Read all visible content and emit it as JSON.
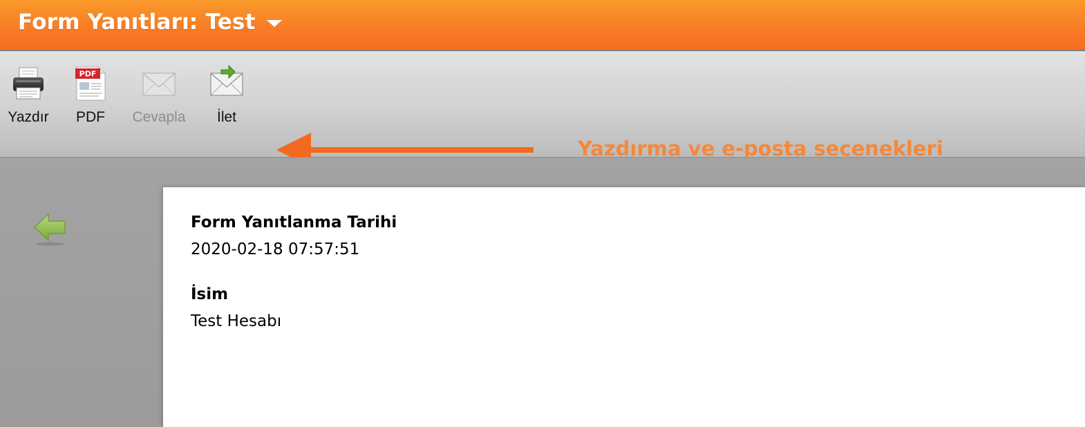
{
  "header": {
    "title": "Form Yanıtları: Test",
    "bg_color": "#f87a26"
  },
  "toolbar": {
    "items": [
      {
        "label": "Yazdır",
        "icon": "printer-icon",
        "enabled": true
      },
      {
        "label": "PDF",
        "icon": "pdf-icon",
        "icon_text": "PDF",
        "enabled": true
      },
      {
        "label": "Cevapla",
        "icon": "envelope-icon",
        "enabled": false
      },
      {
        "label": "İlet",
        "icon": "forward-envelope-icon",
        "enabled": true
      }
    ],
    "annotation": {
      "text": "Yazdırma ve e-posta seçenekleri",
      "color": "#f5883a",
      "arrow_color": "#f26a1f"
    }
  },
  "nav": {
    "back_icon": "back-arrow-icon",
    "back_color": "#8fbf4a"
  },
  "submission": {
    "fields": [
      {
        "label": "Form Yanıtlanma Tarihi",
        "value": "2020-02-18 07:57:51"
      },
      {
        "label": "İsim",
        "value": "Test Hesabı"
      }
    ]
  }
}
